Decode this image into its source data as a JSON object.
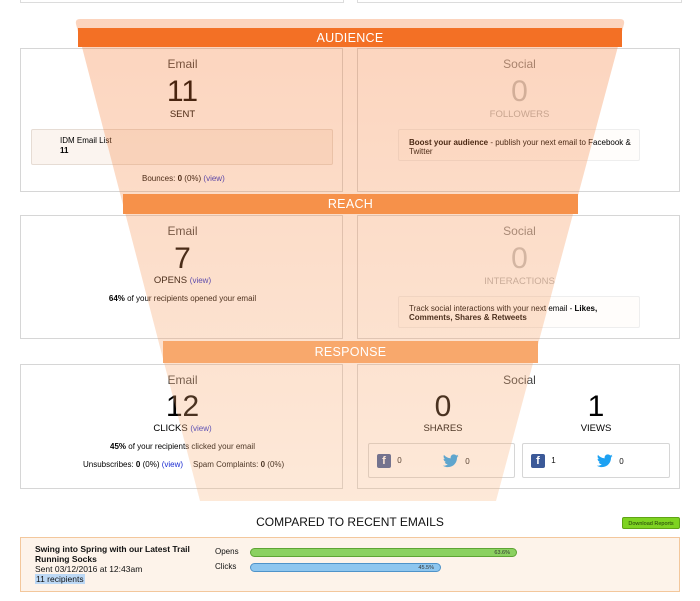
{
  "colors": {
    "funnel_top": "#f37025",
    "funnel_bottom": "#f9b57f",
    "opens_bar": "#8bd160",
    "clicks_bar": "#8ec6ef",
    "download_button": "#7ed321"
  },
  "bands": {
    "audience": "AUDIENCE",
    "reach": "REACH",
    "response": "RESPONSE"
  },
  "audience": {
    "email": {
      "title": "Email",
      "count": "11",
      "count_label": "SENT",
      "list_name": "IDM Email List",
      "list_count": "11",
      "bounces_label": "Bounces:",
      "bounces_value": "0",
      "bounces_pct": "(0%)",
      "view_link": "(view)"
    },
    "social": {
      "title": "Social",
      "count": "0",
      "count_label": "FOLLOWERS",
      "tip_bold": "Boost your audience",
      "tip_rest": " - publish your next email to Facebook & Twitter"
    }
  },
  "reach": {
    "email": {
      "title": "Email",
      "count": "7",
      "count_label": "OPENS",
      "view_link": "(view)",
      "summary_bold": "64%",
      "summary_rest": " of your recipients opened your email"
    },
    "social": {
      "title": "Social",
      "count": "0",
      "count_label": "INTERACTIONS",
      "tip_plain": "Track social interactions with your next email - ",
      "tip_bold": "Likes, Comments, Shares & Retweets"
    }
  },
  "response": {
    "email": {
      "title": "Email",
      "count": "12",
      "count_label": "CLICKS",
      "view_link": "(view)",
      "summary_bold": "45%",
      "summary_rest": " of your recipients clicked your email",
      "unsub_label": "Unsubscribes:",
      "unsub_value": "0",
      "unsub_pct": "(0%)",
      "unsub_view": "(view)",
      "spam_label": "Spam Complaints:",
      "spam_value": "0",
      "spam_pct": "(0%)"
    },
    "social": {
      "title": "Social",
      "shares_count": "0",
      "shares_label": "SHARES",
      "shares_facebook": "0",
      "shares_twitter": "0",
      "views_count": "1",
      "views_label": "VIEWS",
      "views_facebook": "1",
      "views_twitter": "0"
    }
  },
  "compare": {
    "heading": "COMPARED TO RECENT EMAILS",
    "download_button": "Download Reports",
    "email_title": "Swing into Spring with our Latest Trail Running Socks",
    "sent_date": "Sent 03/12/2016 at 12:43am",
    "recipients": "11 recipients",
    "opens_label": "Opens",
    "opens_pct_text": "63.6%",
    "opens_value": 0.636,
    "clicks_label": "Clicks",
    "clicks_pct_text": "45.5%",
    "clicks_value": 0.455
  }
}
